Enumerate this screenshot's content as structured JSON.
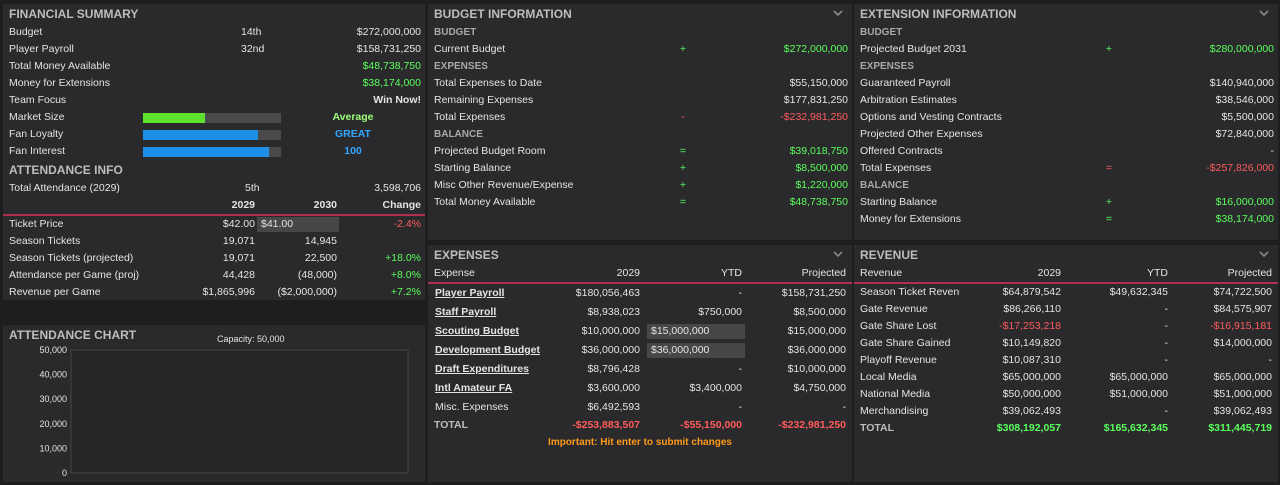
{
  "colors": {
    "positive": "#5bff5b",
    "negative": "#ff5b5b",
    "blue": "#33a6ff",
    "accent_line": "#b03050",
    "panel_bg": "#2a2a2d",
    "bar_green": "#5de22d",
    "bar_blue": "#1e8fe6"
  },
  "financial_summary": {
    "title": "FINANCIAL SUMMARY",
    "rows": [
      {
        "label": "Budget",
        "rank": "14th",
        "value": "$272,000,000"
      },
      {
        "label": "Player Payroll",
        "rank": "32nd",
        "value": "$158,731,250"
      },
      {
        "label": "Total Money Available",
        "rank": "",
        "value": "$48,738,750"
      },
      {
        "label": "Money for Extensions",
        "rank": "",
        "value": "$38,174,000"
      },
      {
        "label": "Team Focus",
        "rank": "",
        "value": "Win Now!"
      }
    ],
    "bars": [
      {
        "label": "Market Size",
        "value_text": "Average",
        "fill_pct": 45
      },
      {
        "label": "Fan Loyalty",
        "value_text": "GREAT",
        "fill_pct": 83
      },
      {
        "label": "Fan Interest",
        "value_text": "100",
        "fill_pct": 91
      }
    ]
  },
  "attendance_info": {
    "title": "ATTENDANCE INFO",
    "total": {
      "label": "Total Attendance (2029)",
      "rank": "5th",
      "value": "3,598,706"
    },
    "headers": [
      "",
      "2029",
      "2030",
      "Change"
    ],
    "rows": [
      {
        "label": "Ticket Price",
        "y2029": "$42.00",
        "y2030": "$41.00",
        "change": "-2.4%",
        "editable": true
      },
      {
        "label": "Season Tickets",
        "y2029": "19,071",
        "y2030": "14,945",
        "change": "",
        "editable": false
      },
      {
        "label": "Season Tickets (projected)",
        "y2029": "19,071",
        "y2030": "22,500",
        "change": "+18.0%",
        "editable": false
      },
      {
        "label": "Attendance per Game (proj)",
        "y2029": "44,428",
        "y2030": "(48,000)",
        "change": "+8.0%",
        "editable": false
      },
      {
        "label": "Revenue per Game",
        "y2029": "$1,865,996",
        "y2030": "($2,000,000)",
        "change": "+7.2%",
        "editable": false
      }
    ]
  },
  "attendance_chart": {
    "title": "ATTENDANCE CHART",
    "capacity_label": "Capacity: 50,000",
    "y_ticks": [
      "50,000",
      "40,000",
      "30,000",
      "20,000",
      "10,000",
      "0"
    ]
  },
  "budget_information": {
    "title": "BUDGET INFORMATION",
    "sections": [
      {
        "heading": "BUDGET",
        "rows": [
          {
            "label": "Current Budget",
            "op": "+",
            "value": "$272,000,000",
            "tone": "g"
          }
        ]
      },
      {
        "heading": "EXPENSES",
        "rows": [
          {
            "label": "Total Expenses to Date",
            "op": "",
            "value": "$55,150,000",
            "tone": ""
          },
          {
            "label": "Remaining Expenses",
            "op": "",
            "value": "$177,831,250",
            "tone": ""
          },
          {
            "label": "Total Expenses",
            "op": "-",
            "value": "-$232,981,250",
            "tone": "rd"
          }
        ]
      },
      {
        "heading": "BALANCE",
        "rows": [
          {
            "label": "Projected Budget Room",
            "op": "=",
            "value": "$39,018,750",
            "tone": "g"
          },
          {
            "label": "Starting Balance",
            "op": "+",
            "value": "$8,500,000",
            "tone": "g"
          },
          {
            "label": "Misc Other Revenue/Expense",
            "op": "+",
            "value": "$1,220,000",
            "tone": "g"
          },
          {
            "label": "Total Money Available",
            "op": "=",
            "value": "$48,738,750",
            "tone": "g"
          }
        ]
      }
    ]
  },
  "extension_information": {
    "title": "EXTENSION INFORMATION",
    "sections": [
      {
        "heading": "BUDGET",
        "rows": [
          {
            "label": "Projected Budget 2031",
            "op": "+",
            "value": "$280,000,000",
            "tone": "g"
          }
        ]
      },
      {
        "heading": "EXPENSES",
        "rows": [
          {
            "label": "Guaranteed Payroll",
            "op": "",
            "value": "$140,940,000",
            "tone": ""
          },
          {
            "label": "Arbitration Estimates",
            "op": "",
            "value": "$38,546,000",
            "tone": ""
          },
          {
            "label": "Options and Vesting Contracts",
            "op": "",
            "value": "$5,500,000",
            "tone": ""
          },
          {
            "label": "Projected Other Expenses",
            "op": "",
            "value": "$72,840,000",
            "tone": ""
          },
          {
            "label": "Offered Contracts",
            "op": "",
            "value": "-",
            "tone": ""
          },
          {
            "label": "Total Expenses",
            "op": "=",
            "value": "-$257,826,000",
            "tone": "rd"
          }
        ]
      },
      {
        "heading": "BALANCE",
        "rows": [
          {
            "label": "Starting Balance",
            "op": "+",
            "value": "$16,000,000",
            "tone": "g"
          },
          {
            "label": "Money for Extensions",
            "op": "=",
            "value": "$38,174,000",
            "tone": "g"
          }
        ]
      }
    ]
  },
  "expenses": {
    "title": "EXPENSES",
    "headers": [
      "Expense",
      "2029",
      "YTD",
      "Projected"
    ],
    "rows": [
      {
        "label": "Player Payroll",
        "y2029": "$180,056,463",
        "ytd": "-",
        "proj": "$158,731,250",
        "link": true,
        "editable": false
      },
      {
        "label": "Staff Payroll",
        "y2029": "$8,938,023",
        "ytd": "$750,000",
        "proj": "$8,500,000",
        "link": true,
        "editable": false
      },
      {
        "label": "Scouting Budget",
        "y2029": "$10,000,000",
        "ytd": "$15,000,000",
        "proj": "$15,000,000",
        "link": true,
        "editable": true
      },
      {
        "label": "Development Budget",
        "y2029": "$36,000,000",
        "ytd": "$36,000,000",
        "proj": "$36,000,000",
        "link": true,
        "editable": true
      },
      {
        "label": "Draft Expenditures",
        "y2029": "$8,796,428",
        "ytd": "-",
        "proj": "$10,000,000",
        "link": true,
        "editable": false
      },
      {
        "label": "Intl Amateur FA",
        "y2029": "$3,600,000",
        "ytd": "$3,400,000",
        "proj": "$4,750,000",
        "link": true,
        "editable": false
      },
      {
        "label": "Misc. Expenses",
        "y2029": "$6,492,593",
        "ytd": "-",
        "proj": "-",
        "link": false,
        "editable": false
      }
    ],
    "total": {
      "label": "TOTAL",
      "y2029": "-$253,883,507",
      "ytd": "-$55,150,000",
      "proj": "-$232,981,250"
    },
    "note": "Important: Hit enter to submit changes"
  },
  "revenue": {
    "title": "REVENUE",
    "headers": [
      "Revenue",
      "2029",
      "YTD",
      "Projected"
    ],
    "rows": [
      {
        "label": "Season Ticket Revenue",
        "y2029": "$64,879,542",
        "ytd": "$49,632,345",
        "proj": "$74,722,500",
        "t29": "",
        "tp": ""
      },
      {
        "label": "Gate Revenue",
        "y2029": "$86,266,110",
        "ytd": "-",
        "proj": "$84,575,907",
        "t29": "",
        "tp": ""
      },
      {
        "label": "Gate Share Lost",
        "y2029": "-$17,253,218",
        "ytd": "-",
        "proj": "-$16,915,181",
        "t29": "rd",
        "tp": "rd"
      },
      {
        "label": "Gate Share Gained",
        "y2029": "$10,149,820",
        "ytd": "-",
        "proj": "$14,000,000",
        "t29": "",
        "tp": ""
      },
      {
        "label": "Playoff Revenue",
        "y2029": "$10,087,310",
        "ytd": "-",
        "proj": "-",
        "t29": "",
        "tp": ""
      },
      {
        "label": "Local Media",
        "y2029": "$65,000,000",
        "ytd": "$65,000,000",
        "proj": "$65,000,000",
        "t29": "",
        "tp": ""
      },
      {
        "label": "National Media",
        "y2029": "$50,000,000",
        "ytd": "$51,000,000",
        "proj": "$51,000,000",
        "t29": "",
        "tp": ""
      },
      {
        "label": "Merchandising",
        "y2029": "$39,062,493",
        "ytd": "-",
        "proj": "$39,062,493",
        "t29": "",
        "tp": ""
      }
    ],
    "total": {
      "label": "TOTAL",
      "y2029": "$308,192,057",
      "ytd": "$165,632,345",
      "proj": "$311,445,719"
    }
  }
}
